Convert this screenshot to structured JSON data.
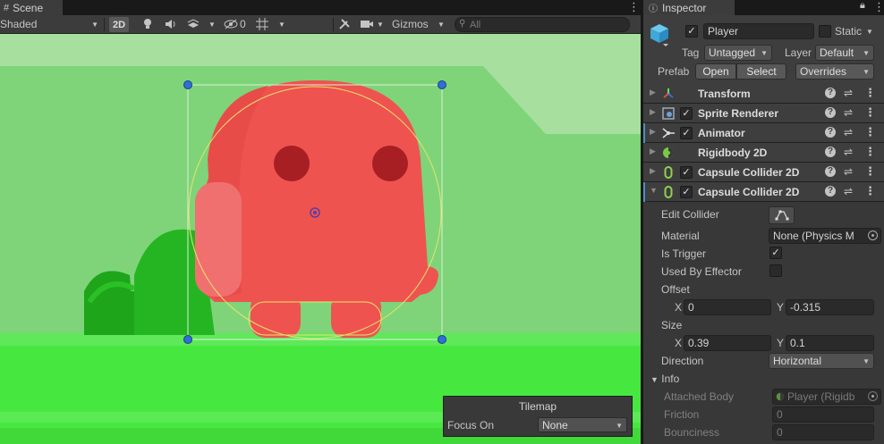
{
  "scene": {
    "tab_label": "Scene",
    "shading_mode": "Shaded",
    "mode_2d": "2D",
    "hidden_count": "0",
    "gizmos_label": "Gizmos",
    "search_placeholder": "All",
    "tilemap_overlay": {
      "title": "Tilemap",
      "focus_label": "Focus On",
      "focus_value": "None"
    }
  },
  "inspector": {
    "tab_label": "Inspector",
    "object_name": "Player",
    "static_label": "Static",
    "tag_label": "Tag",
    "tag_value": "Untagged",
    "layer_label": "Layer",
    "layer_value": "Default",
    "prefab_label": "Prefab",
    "open_label": "Open",
    "select_label": "Select",
    "overrides_label": "Overrides",
    "components": [
      {
        "name": "Transform",
        "icon": "transform-icon",
        "has_checkbox": false
      },
      {
        "name": "Sprite Renderer",
        "icon": "sprite-renderer-icon",
        "has_checkbox": true
      },
      {
        "name": "Animator",
        "icon": "animator-icon",
        "has_checkbox": true
      },
      {
        "name": "Rigidbody 2D",
        "icon": "rigidbody-icon",
        "has_checkbox": false
      },
      {
        "name": "Capsule Collider 2D",
        "icon": "capsule-collider-icon",
        "has_checkbox": true
      },
      {
        "name": "Capsule Collider 2D",
        "icon": "capsule-collider-icon",
        "has_checkbox": true
      }
    ],
    "collider": {
      "edit_collider_label": "Edit Collider",
      "material_label": "Material",
      "material_value": "None (Physics M",
      "is_trigger_label": "Is Trigger",
      "is_trigger": true,
      "used_by_effector_label": "Used By Effector",
      "used_by_effector": false,
      "offset_label": "Offset",
      "offset_x_label": "X",
      "offset_x": "0",
      "offset_y_label": "Y",
      "offset_y": "-0.315",
      "size_label": "Size",
      "size_x_label": "X",
      "size_x": "0.39",
      "size_y_label": "Y",
      "size_y": "0.1",
      "direction_label": "Direction",
      "direction_value": "Horizontal",
      "info_label": "Info",
      "attached_body_label": "Attached Body",
      "attached_body_value": "Player (Rigidb",
      "friction_label": "Friction",
      "friction_value": "0",
      "bounciness_label": "Bounciness",
      "bounciness_value": "0"
    }
  },
  "colors": {
    "character_red": "#ee5350",
    "gizmo_blue": "#2f6fd6",
    "collider_outline": "#e8e36a",
    "accent_blue": "#4a90c2"
  }
}
